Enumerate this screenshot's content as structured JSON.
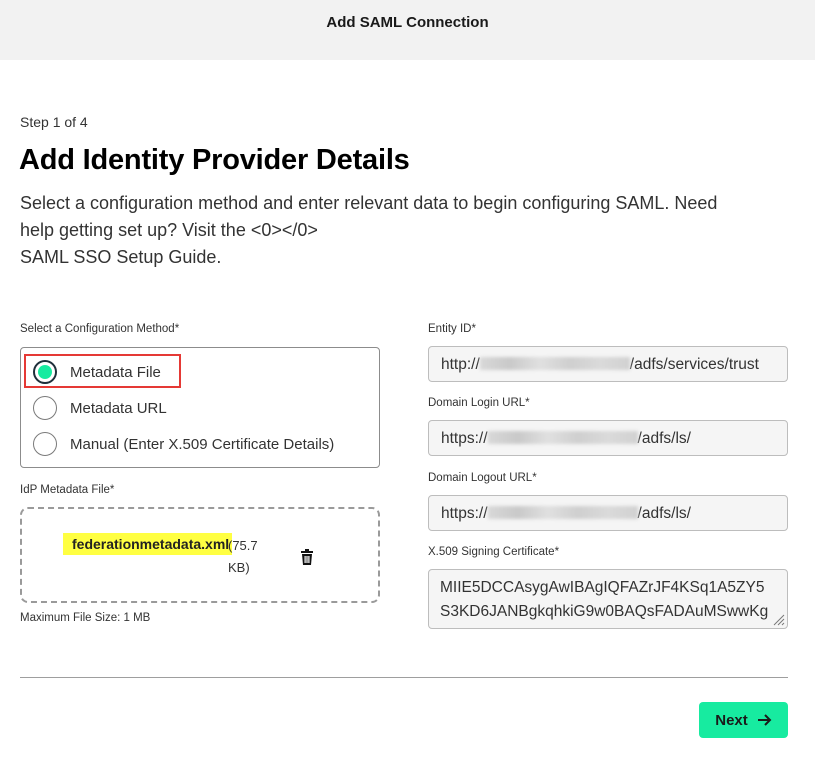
{
  "header": {
    "title": "Add SAML Connection"
  },
  "step": {
    "text": "Step 1 of 4"
  },
  "page": {
    "heading": "Add Identity Provider Details",
    "description_lines": [
      "Select a configuration method and enter relevant data to begin configuring SAML. Need",
      "help getting set up? Visit the <0></0>",
      "SAML SSO Setup Guide."
    ]
  },
  "config_method": {
    "label": "Select a Configuration Method*",
    "options": [
      {
        "label": "Metadata File",
        "checked": true
      },
      {
        "label": "Metadata URL",
        "checked": false
      },
      {
        "label": "Manual (Enter X.509 Certificate Details)",
        "checked": false
      }
    ]
  },
  "metadata_file": {
    "label": "IdP Metadata File*",
    "file_name": "federationmetadata.xml",
    "file_size": "(75.7 KB)",
    "max_size_note": "Maximum File Size: 1 MB"
  },
  "entity_id": {
    "label": "Entity ID*",
    "prefix": "http://",
    "suffix": "/adfs/services/trust"
  },
  "domain_login_url": {
    "label": "Domain Login URL*",
    "prefix": "https://",
    "suffix": "/adfs/ls/"
  },
  "domain_logout_url": {
    "label": "Domain Logout URL*",
    "prefix": "https://",
    "suffix": "/adfs/ls/"
  },
  "signing_certificate": {
    "label": "X.509 Signing Certificate*",
    "lines": [
      "MIIE5DCCAsygAwIBAgIQFAZrJF4KSq1A5ZY5",
      "S3KD6JANBgkqhkiG9w0BAQsFADAuMSwwKg"
    ]
  },
  "footer": {
    "next_label": "Next"
  },
  "colors": {
    "accent": "#17eba0",
    "highlight": "#ffff42",
    "annotation_border": "#e53935"
  },
  "icons": {
    "trash": "trash-icon",
    "next_arrow": "arrow-right-icon"
  }
}
